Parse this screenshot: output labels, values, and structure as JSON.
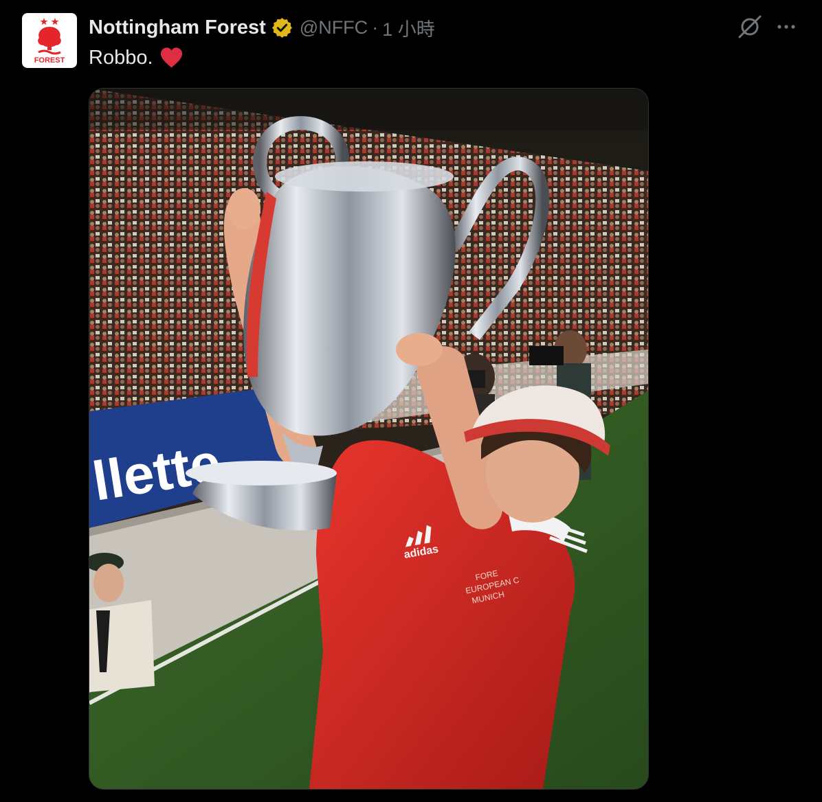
{
  "tweet": {
    "author": {
      "display_name": "Nottingham Forest",
      "handle": "@NFFC",
      "avatar_text": "FOREST",
      "verified_badge_color": "#e2b719"
    },
    "separator": "·",
    "timestamp": "1 小時",
    "text": "Robbo.",
    "emoji": "heart-emoji",
    "media": {
      "type": "photo",
      "banner_text": "llette",
      "shirt_brand": "adidas",
      "shirt_crest_lines": [
        "FORE",
        "EUROPEAN C",
        "MUNICH"
      ]
    },
    "actions": {
      "grok_icon": "grok-icon",
      "more_icon": "more-horizontal-icon"
    }
  },
  "theme": {
    "background": "#000000",
    "primary_text": "#e7e9ea",
    "secondary_text": "#71767b",
    "forest_red": "#e5252c"
  }
}
